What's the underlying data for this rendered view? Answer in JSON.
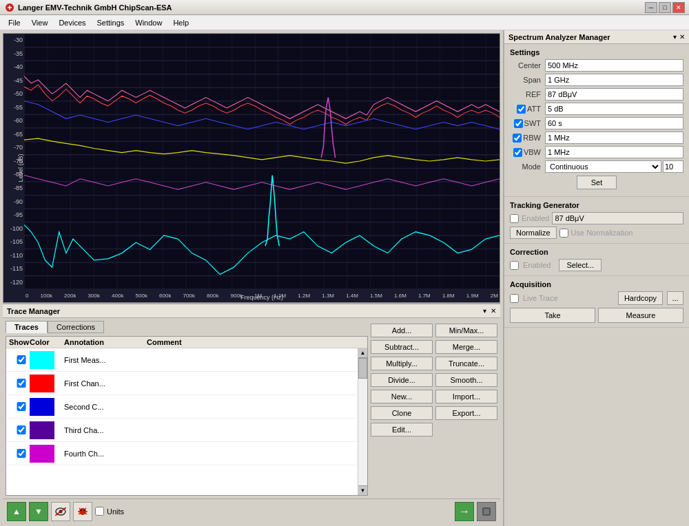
{
  "titleBar": {
    "icon": "◉",
    "title": "Langer EMV-Technik GmbH ChipScan-ESA",
    "minBtn": "─",
    "maxBtn": "□",
    "closeBtn": "✕"
  },
  "menuBar": {
    "items": [
      "File",
      "View",
      "Devices",
      "Settings",
      "Window",
      "Help"
    ]
  },
  "chart": {
    "yAxisTitle": "Level (dB)",
    "xAxisTitle": "Frequency (Hz)",
    "yLabels": [
      "-30",
      "-35",
      "-40",
      "-45",
      "-50",
      "-55",
      "-60",
      "-65",
      "-70",
      "-75",
      "-80",
      "-85",
      "-90",
      "-95",
      "-100",
      "-105",
      "-110",
      "-115",
      "-120"
    ],
    "xLabels": [
      "0",
      "100k",
      "200k",
      "300k",
      "400k",
      "500k",
      "600k",
      "700k",
      "800k",
      "900k",
      "1M",
      "1.1M",
      "1.2M",
      "1.3M",
      "1.4M",
      "1.5M",
      "1.6M",
      "1.7M",
      "1.8M",
      "1.9M",
      "2M"
    ]
  },
  "rightPanel": {
    "title": "Spectrum  Analyzer Manager",
    "pin": "▾",
    "close": "✕"
  },
  "settings": {
    "title": "Settings",
    "center": {
      "label": "Center",
      "value": "500 MHz"
    },
    "span": {
      "label": "Span",
      "value": "1 GHz"
    },
    "ref": {
      "label": "REF",
      "value": "87 dBμV"
    },
    "att": {
      "label": "ATT",
      "value": "5 dB",
      "checked": true
    },
    "swt": {
      "label": "SWT",
      "value": "60 s",
      "checked": true
    },
    "rbw": {
      "label": "RBW",
      "value": "1 MHz",
      "checked": true
    },
    "vbw": {
      "label": "VBW",
      "value": "1 MHz",
      "checked": true
    },
    "mode": {
      "label": "Mode",
      "value": "Continuous",
      "number": "10"
    },
    "setBtn": "Set"
  },
  "trackingGenerator": {
    "title": "Tracking Generator",
    "enabled": {
      "label": "Enabled",
      "checked": false
    },
    "value": "87 dBμV",
    "normalizeBtn": "Normalize",
    "useNormalization": {
      "label": "Use Normalization",
      "checked": false
    }
  },
  "correction": {
    "title": "Correction",
    "enabled": {
      "label": "Enabled",
      "checked": false
    },
    "selectBtn": "Select..."
  },
  "acquisition": {
    "title": "Acquisition",
    "liveTrace": {
      "label": "Live Trace",
      "checked": false
    },
    "hardcopyBtn": "Hardcopy",
    "dotsBtn": "...",
    "takeBtn": "Take",
    "measureBtn": "Measure"
  },
  "traceManager": {
    "title": "Trace Manager",
    "tabs": [
      "Traces",
      "Corrections"
    ],
    "tableHeaders": [
      "Show",
      "Color",
      "Annotation",
      "Comment"
    ],
    "rows": [
      {
        "show": true,
        "color": "#00ffff",
        "annotation": "First Meas...",
        "comment": ""
      },
      {
        "show": true,
        "color": "#ff0000",
        "annotation": "First Chan...",
        "comment": ""
      },
      {
        "show": true,
        "color": "#0000dd",
        "annotation": "Second C...",
        "comment": ""
      },
      {
        "show": true,
        "color": "#000099",
        "annotation": "Third Cha...",
        "comment": ""
      },
      {
        "show": true,
        "color": "#cc00cc",
        "annotation": "Fourth Ch...",
        "comment": ""
      }
    ],
    "buttons": {
      "add": "Add...",
      "minMax": "Min/Max...",
      "subtract": "Subtract...",
      "merge": "Merge...",
      "multiply": "Multiply...",
      "truncate": "Truncate...",
      "divide": "Divide...",
      "smooth": "Smooth...",
      "new": "New...",
      "import": "Import...",
      "clone": "Clone",
      "export": "Export...",
      "edit": "Edit..."
    }
  },
  "toolbar": {
    "upArrow": "▲",
    "downArrow": "▼",
    "eyeIcon": "👁",
    "bugIcon": "🐛",
    "unitsLabel": "Units",
    "rightArrow": "→",
    "dbIcon": "▣"
  }
}
